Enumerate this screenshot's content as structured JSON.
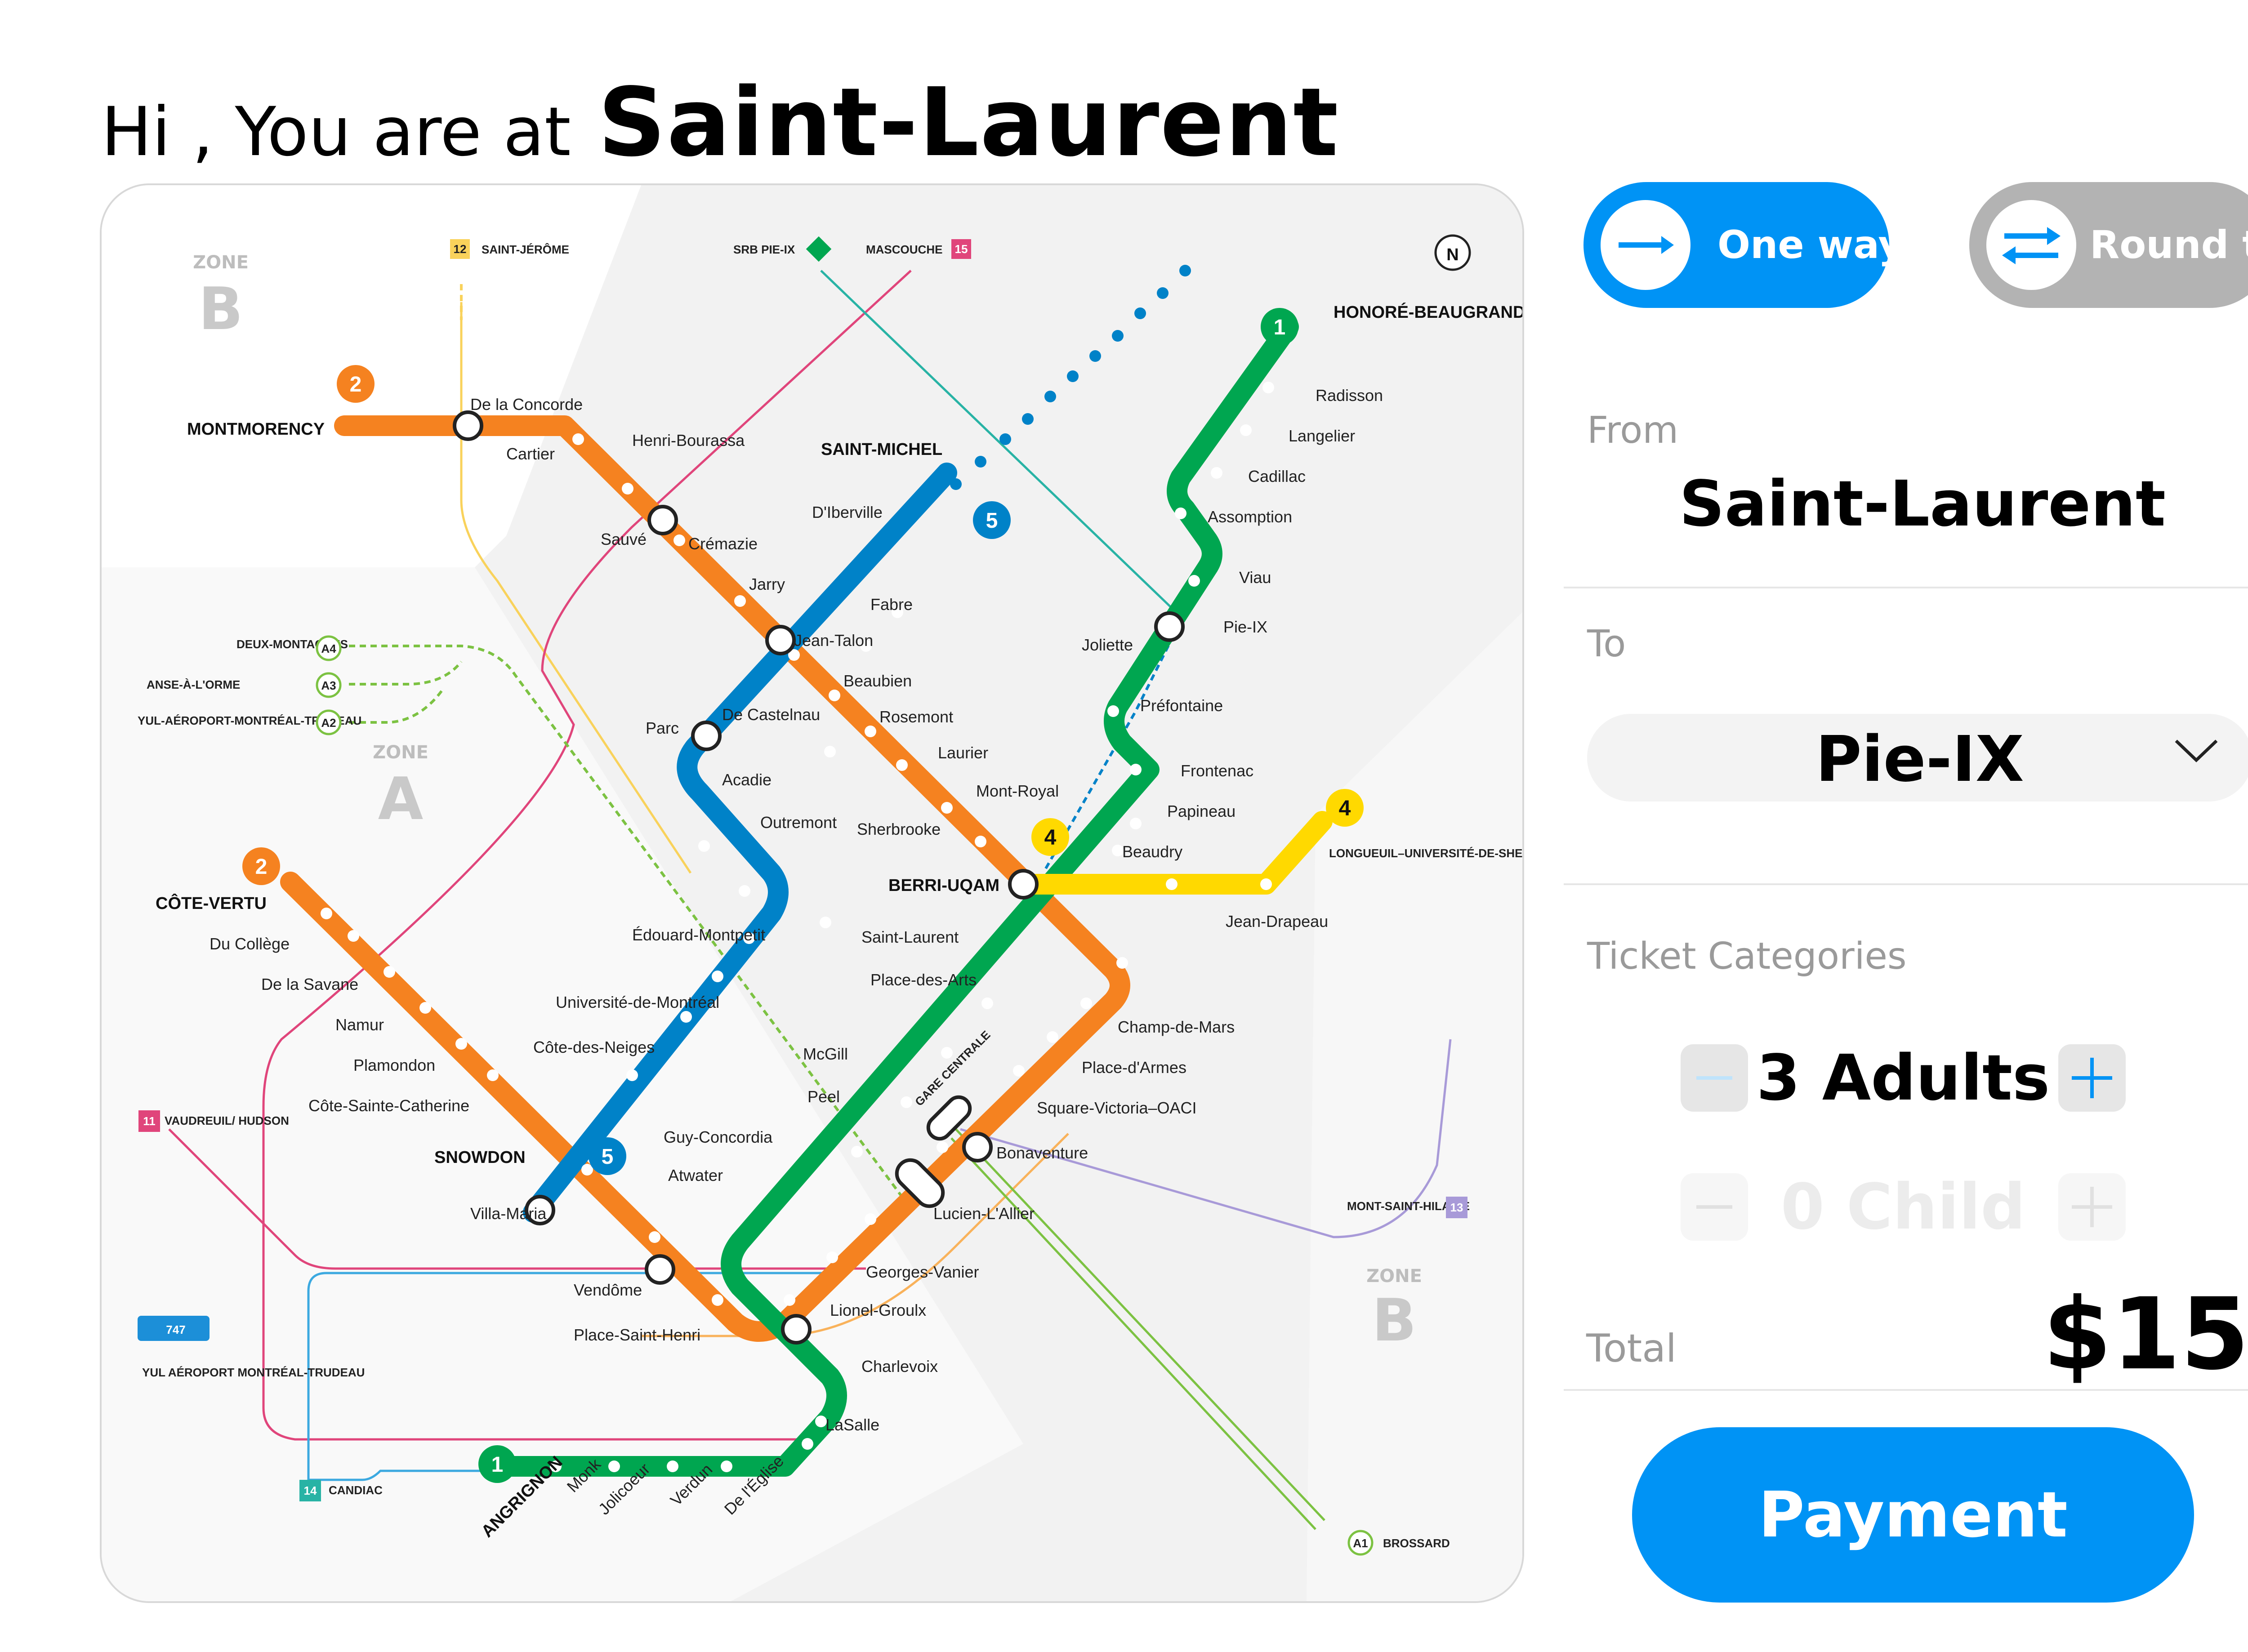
{
  "header": {
    "greeting": "Hi , You are at",
    "station": "Saint-Laurent"
  },
  "trip_type": {
    "one_way_label": "One way",
    "round_trip_label": "Round trip",
    "selected": "One way",
    "one_way_icon": "arrow-right-icon",
    "round_trip_icon": "swap-arrows-icon"
  },
  "form": {
    "from_label": "From",
    "from_value": "Saint-Laurent",
    "to_label": "To",
    "to_value": "Pie-IX",
    "categories_label": "Ticket Categories",
    "adults": "3 Adults",
    "children": "0 Child",
    "total_label": "Total",
    "total_value": "$15",
    "payment_label": "Payment"
  },
  "colors": {
    "accent": "#0093f5",
    "toggle_inactive": "#b3b3b3",
    "line_orange": "#f58220",
    "line_green": "#00a650",
    "line_blue": "#0082c8",
    "line_yellow": "#ffd900"
  },
  "map": {
    "zones": [
      {
        "word": "ZONE",
        "letter": "B"
      },
      {
        "word": "ZONE",
        "letter": "A"
      },
      {
        "word": "ZONE",
        "letter": "B"
      }
    ],
    "terminals": {
      "montmorency": "MONTMORENCY",
      "honore": "HONORÉ-BEAUGRAND",
      "cote_vertu": "CÔTE-VERTU",
      "angrignon": "ANGRIGNON",
      "saint_michel": "SAINT-MICHEL",
      "snowdon": "SNOWDON",
      "longueuil": "LONGUEUIL–UNIVERSITÉ-DE-SHERBROOKE",
      "berri": "BERRI-UQAM"
    },
    "stations": {
      "de_la_concorde": "De la Concorde",
      "cartier": "Cartier",
      "henri_bourassa": "Henri-Bourassa",
      "sauve": "Sauvé",
      "cremazie": "Crémazie",
      "jarry": "Jarry",
      "jean_talon": "Jean-Talon",
      "beaubien": "Beaubien",
      "rosemont": "Rosemont",
      "laurier": "Laurier",
      "mont_royal": "Mont-Royal",
      "sherbrooke": "Sherbrooke",
      "dibreville": "D'Iberville",
      "fabre": "Fabre",
      "de_castelnau": "De Castelnau",
      "parc": "Parc",
      "acadie": "Acadie",
      "outremont": "Outremont",
      "edouard": "Édouard-Montpetit",
      "udem": "Université-de-Montréal",
      "cote_des_neiges": "Côte-des-Neiges",
      "radisson": "Radisson",
      "langelier": "Langelier",
      "cadillac": "Cadillac",
      "assomption": "Assomption",
      "viau": "Viau",
      "pie_ix": "Pie-IX",
      "joliette": "Joliette",
      "prefontaine": "Préfontaine",
      "frontenac": "Frontenac",
      "papineau": "Papineau",
      "beaudry": "Beaudry",
      "saint_laurent": "Saint-Laurent",
      "place_des_arts": "Place-des-Arts",
      "mcgill": "McGill",
      "peel": "Peel",
      "guy_concordia": "Guy-Concordia",
      "atwater": "Atwater",
      "lucien_lallier": "Lucien-L'Allier",
      "georges_vanier": "Georges-Vanier",
      "lionel_groulx": "Lionel-Groulx",
      "charlevoix": "Charlevoix",
      "lasalle": "LaSalle",
      "de_leglise": "De l'Église",
      "verdun": "Verdun",
      "jolicoeur": "Jolicoeur",
      "monk": "Monk",
      "du_college": "Du Collège",
      "de_la_savane": "De la Savane",
      "namur": "Namur",
      "plamondon": "Plamondon",
      "cote_sainte_catherine": "Côte-Sainte-Catherine",
      "villa_maria": "Villa-Maria",
      "vendome": "Vendôme",
      "place_saint_henri": "Place-Saint-Henri",
      "bonaventure": "Bonaventure",
      "square_victoria": "Square-Victoria–OACI",
      "place_darmes": "Place-d'Armes",
      "champ_de_mars": "Champ-de-Mars",
      "jean_drapeau": "Jean-Drapeau",
      "gare_centrale": "GARE CENTRALE"
    },
    "regional": {
      "saint_jerome": "SAINT-JÉRÔME",
      "srb": "SRB PIE-IX",
      "mascouche": "MASCOUCHE",
      "deux_montagnes": "DEUX-MONTAGNES",
      "anse": "ANSE-À-L'ORME",
      "yul": "YUL-AÉROPORT-MONTRÉAL-TRUDEAU",
      "vaudreuil": "VAUDREUIL/ HUDSON",
      "mont_saint_hilaire": "MONT-SAINT-HILAIRE",
      "candiac": "CANDIAC",
      "brossard": "BROSSARD",
      "bus": "747",
      "yul_short": "YUL AÉROPORT MONTRÉAL-TRUDEAU"
    },
    "badges": {
      "l1": "1",
      "l2": "2",
      "l4": "4",
      "l5": "5",
      "n12": "12",
      "n15": "15",
      "n11": "11",
      "n13": "13",
      "n14": "14",
      "a1": "A1",
      "a2": "A2",
      "a3": "A3",
      "a4": "A4",
      "north": "N"
    }
  }
}
